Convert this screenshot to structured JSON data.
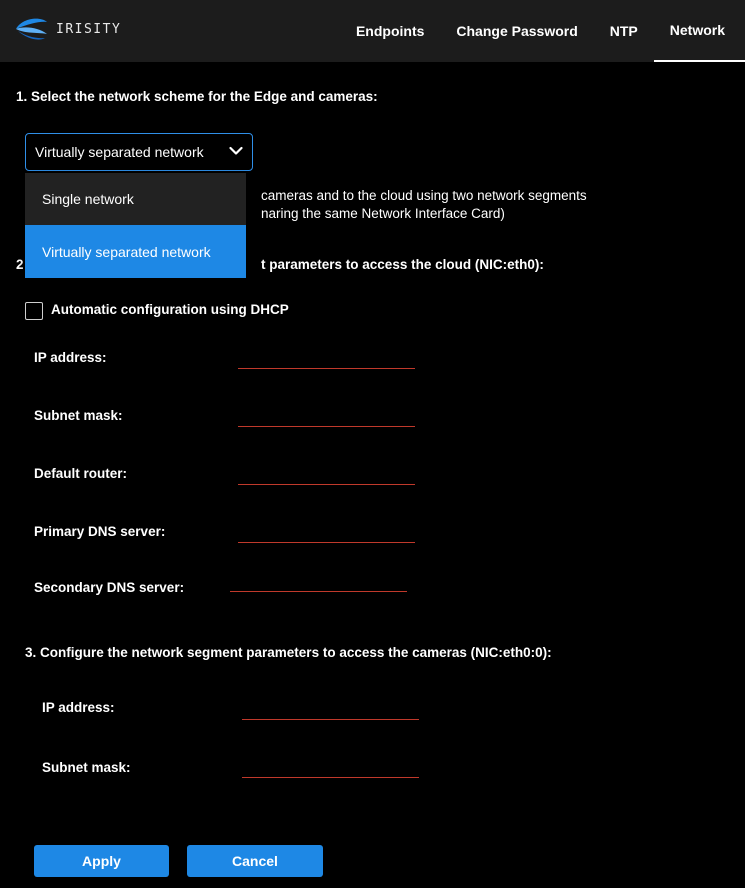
{
  "app": {
    "brand": "IRISITY"
  },
  "nav": [
    {
      "label": "Endpoints"
    },
    {
      "label": "Change Password"
    },
    {
      "label": "NTP"
    },
    {
      "label": "Network"
    }
  ],
  "step1": {
    "heading": "1. Select the network scheme for the Edge and cameras:",
    "selected_value": "Virtually separated network",
    "options": [
      {
        "label": "Single network"
      },
      {
        "label": "Virtually separated network"
      }
    ],
    "description_line1": "cameras and to the cloud using two network segments",
    "description_line2": "naring the same Network Interface Card)"
  },
  "step2": {
    "heading_prefix": "2",
    "heading_suffix": "t parameters to access the cloud (NIC:eth0):",
    "dhcp_label": "Automatic configuration using DHCP",
    "dhcp_checked": false,
    "fields": [
      {
        "label": "IP address:",
        "value": ""
      },
      {
        "label": "Subnet mask:",
        "value": ""
      },
      {
        "label": "Default router:",
        "value": ""
      },
      {
        "label": "Primary DNS server:",
        "value": ""
      },
      {
        "label": "Secondary DNS server:",
        "value": ""
      }
    ]
  },
  "step3": {
    "heading": "3. Configure the network segment parameters to access the cameras (NIC:eth0:0):",
    "fields": [
      {
        "label": "IP address:",
        "value": ""
      },
      {
        "label": "Subnet mask:",
        "value": ""
      }
    ]
  },
  "actions": {
    "apply": "Apply",
    "cancel": "Cancel"
  },
  "colors": {
    "accent": "#1e88e5",
    "field_underline": "#c0392b",
    "topbar": "#1c1c1c"
  },
  "icons": {
    "logo": "irisity-logo",
    "select_chevron": "chevron-down-icon",
    "checkbox": "checkbox-icon"
  }
}
